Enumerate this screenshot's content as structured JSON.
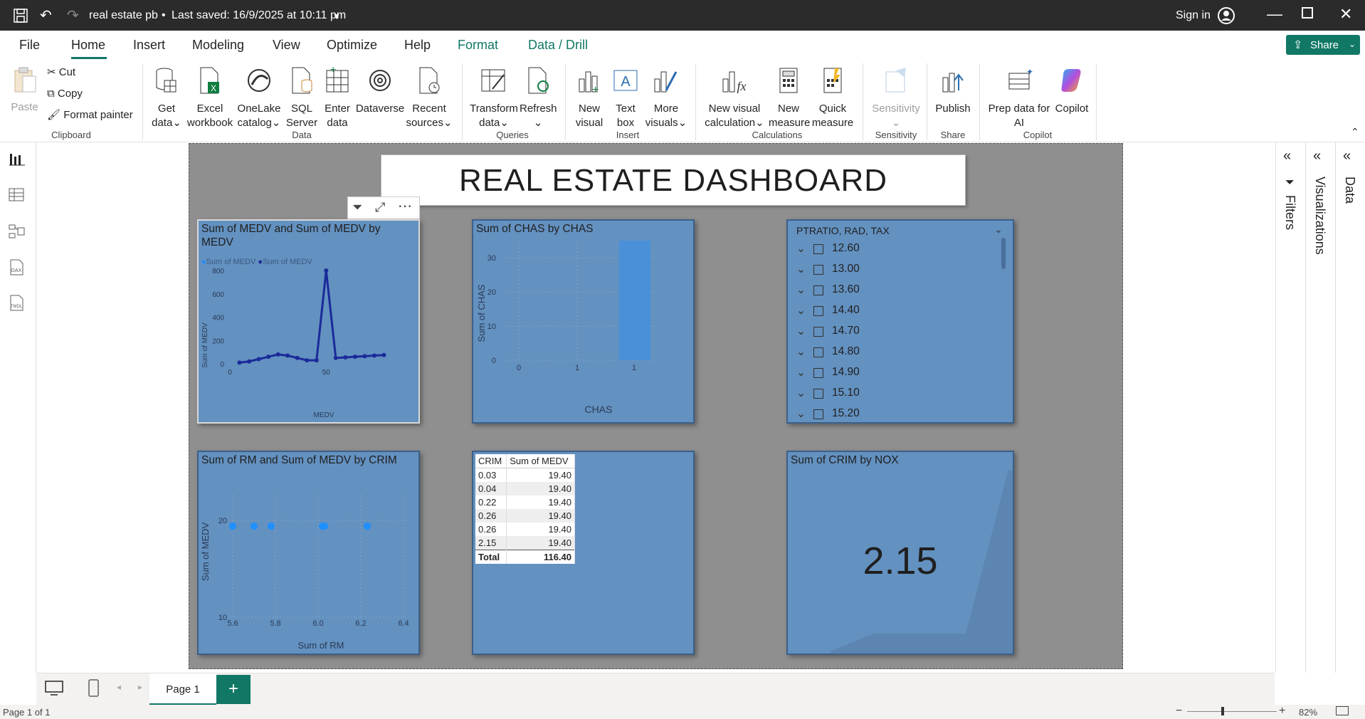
{
  "titlebar": {
    "file_title": "real estate pb",
    "saved_status": "Last saved: 16/9/2025 at 10:11 pm",
    "sign_in": "Sign in"
  },
  "menu": {
    "items": [
      "File",
      "Home",
      "Insert",
      "Modeling",
      "View",
      "Optimize",
      "Help",
      "Format",
      "Data / Drill"
    ],
    "share": "Share"
  },
  "ribbon": {
    "clipboard": {
      "paste": "Paste",
      "cut": "Cut",
      "copy": "Copy",
      "format_painter": "Format painter",
      "group": "Clipboard"
    },
    "data": {
      "get_data": [
        "Get",
        "data"
      ],
      "excel": [
        "Excel",
        "workbook"
      ],
      "onelake": [
        "OneLake",
        "catalog"
      ],
      "sql": [
        "SQL",
        "Server"
      ],
      "enter": [
        "Enter",
        "data"
      ],
      "dataverse": "Dataverse",
      "recent": [
        "Recent",
        "sources"
      ],
      "group": "Data"
    },
    "queries": {
      "transform": [
        "Transform",
        "data"
      ],
      "refresh": "Refresh",
      "group": "Queries"
    },
    "insert": {
      "new_visual": [
        "New",
        "visual"
      ],
      "text_box": [
        "Text",
        "box"
      ],
      "more_visuals": [
        "More",
        "visuals"
      ],
      "group": "Insert"
    },
    "calculations": {
      "new_visual_calc": [
        "New visual",
        "calculation"
      ],
      "new_measure": [
        "New",
        "measure"
      ],
      "quick_measure": [
        "Quick",
        "measure"
      ],
      "group": "Calculations"
    },
    "sensitivity": {
      "label": "Sensitivity",
      "group": "Sensitivity"
    },
    "share": {
      "publish": "Publish",
      "group": "Share"
    },
    "copilot": {
      "prep": [
        "Prep data for",
        "AI"
      ],
      "copilot": "Copilot",
      "group": "Copilot"
    }
  },
  "dashboard": {
    "title": "REAL ESTATE DASHBOARD",
    "v1": {
      "title": "Sum of MEDV and Sum of MEDV by MEDV",
      "legend": [
        "Sum of MEDV",
        "Sum of MEDV"
      ],
      "ylabel": "Sum of MEDV",
      "xlabel": "MEDV",
      "yticks": [
        "800",
        "600",
        "400",
        "200",
        "0"
      ],
      "xticks": [
        "0",
        "50"
      ]
    },
    "v2": {
      "title": "Sum of CHAS by CHAS",
      "ylabel": "Sum of CHAS",
      "xlabel": "CHAS",
      "yticks": [
        "30",
        "20",
        "10",
        "0"
      ],
      "xticks": [
        "0",
        "1",
        "1"
      ]
    },
    "v3": {
      "header": "PTRATIO, RAD, TAX",
      "items": [
        "12.60",
        "13.00",
        "13.60",
        "14.40",
        "14.70",
        "14.80",
        "14.90",
        "15.10",
        "15.20"
      ]
    },
    "v4": {
      "title": "Sum of RM and Sum of MEDV by CRIM",
      "ylabel": "Sum of MEDV",
      "xlabel": "Sum of RM",
      "yticks": [
        "20",
        "10"
      ],
      "xticks": [
        "5.6",
        "5.8",
        "6.0",
        "6.2",
        "6.4"
      ]
    },
    "v5": {
      "headers": [
        "CRIM",
        "Sum of MEDV"
      ],
      "rows": [
        [
          "0.03",
          "19.40"
        ],
        [
          "0.04",
          "19.40"
        ],
        [
          "0.22",
          "19.40"
        ],
        [
          "0.26",
          "19.40"
        ],
        [
          "0.26",
          "19.40"
        ],
        [
          "2.15",
          "19.40"
        ]
      ],
      "total": [
        "Total",
        "116.40"
      ]
    },
    "v6": {
      "title": "Sum of CRIM by NOX",
      "value": "2.15"
    }
  },
  "panes": {
    "filters": "Filters",
    "visualizations": "Visualizations",
    "data": "Data"
  },
  "tabs": {
    "page1": "Page 1",
    "add": "+"
  },
  "status": {
    "page": "Page 1 of 1",
    "zoom": "82%"
  },
  "chart_data": [
    {
      "type": "line",
      "title": "Sum of MEDV and Sum of MEDV by MEDV",
      "xlabel": "MEDV",
      "ylabel": "Sum of MEDV",
      "xlim": [
        0,
        85
      ],
      "ylim": [
        0,
        800
      ],
      "series": [
        {
          "name": "Sum of MEDV",
          "x": [
            5,
            10,
            15,
            20,
            25,
            30,
            35,
            40,
            45,
            50,
            55,
            60,
            65,
            70,
            75,
            80
          ],
          "values": [
            10,
            20,
            40,
            60,
            80,
            70,
            50,
            30,
            30,
            800,
            50,
            55,
            60,
            65,
            70,
            75
          ]
        }
      ]
    },
    {
      "type": "bar",
      "title": "Sum of CHAS by CHAS",
      "xlabel": "CHAS",
      "ylabel": "Sum of CHAS",
      "categories": [
        "0",
        "1"
      ],
      "values": [
        0,
        35
      ],
      "ylim": [
        0,
        35
      ]
    },
    {
      "type": "scatter",
      "title": "Sum of RM and Sum of MEDV by CRIM",
      "xlabel": "Sum of RM",
      "ylabel": "Sum of MEDV",
      "xlim": [
        5.6,
        6.4
      ],
      "ylim": [
        10,
        20
      ],
      "x": [
        5.6,
        5.7,
        5.78,
        6.02,
        6.03,
        6.23
      ],
      "values": [
        19.4,
        19.4,
        19.4,
        19.4,
        19.4,
        19.4
      ]
    }
  ]
}
